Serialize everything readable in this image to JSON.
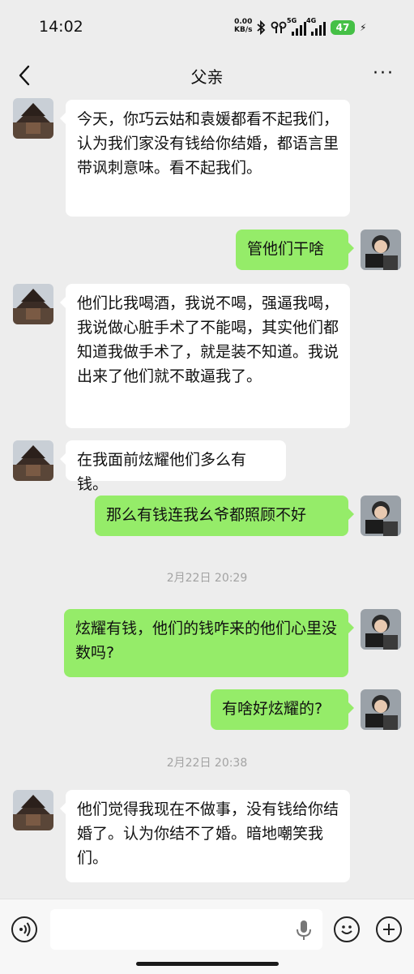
{
  "status_bar": {
    "time": "14:02",
    "net_speed": "0.00",
    "net_unit": "KB/s",
    "sim1": "5G",
    "sim2": "4G",
    "battery": "47"
  },
  "header": {
    "title": "父亲",
    "back_icon": "chevron-left-icon",
    "more_icon": "more-dots-icon",
    "more_label": "···"
  },
  "messages": [
    {
      "side": "left",
      "text": "今天，你巧云姑和袁媛都看不起我们，认为我们家没有钱给你结婚，都语言里带讽刺意味。看不起我们。"
    },
    {
      "side": "right",
      "text": "管他们干啥"
    },
    {
      "side": "left",
      "text": "他们比我喝酒，我说不喝，强逼我喝，我说做心脏手术了不能喝，其实他们都知道我做手术了，就是装不知道。我说出来了他们就不敢逼我了。"
    },
    {
      "side": "left",
      "text": "在我面前炫耀他们多么有钱。"
    },
    {
      "side": "right",
      "text": "那么有钱连我幺爷都照顾不好"
    },
    {
      "timestamp": "2月22日 20:29"
    },
    {
      "side": "right",
      "text": "炫耀有钱，他们的钱咋来的他们心里没数吗?"
    },
    {
      "side": "right",
      "text": "有啥好炫耀的?"
    },
    {
      "timestamp": "2月22日 20:38"
    },
    {
      "side": "left",
      "text": "他们觉得我现在不做事，没有钱给你结婚了。认为你结不了婚。暗地嘲笑我们。"
    }
  ],
  "input_bar": {
    "voice_icon": "voice-mode-icon",
    "mic_icon": "microphone-icon",
    "emoji_icon": "emoji-icon",
    "add_icon": "plus-icon"
  },
  "colors": {
    "background": "#ededed",
    "sent_bubble": "#95ec69",
    "received_bubble": "#ffffff",
    "battery": "#45c046"
  }
}
